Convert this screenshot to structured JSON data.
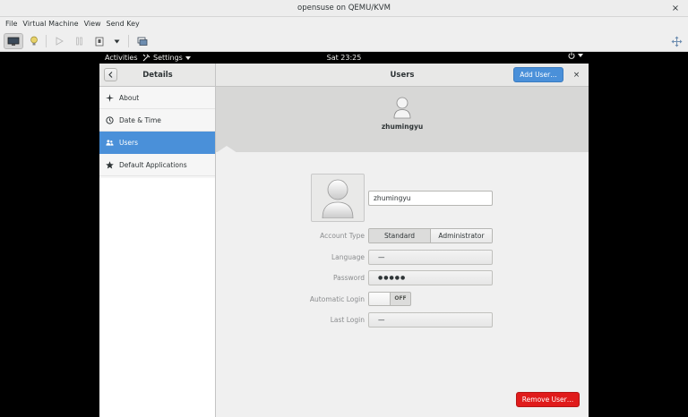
{
  "host": {
    "window_title": "opensuse on QEMU/KVM",
    "close_glyph": "×",
    "menu": [
      "File",
      "Virtual Machine",
      "View",
      "Send Key"
    ],
    "toolbar_icons": [
      "monitor-icon",
      "lightbulb-icon",
      "play-icon",
      "pause-icon",
      "shutdown-icon",
      "dropdown-arrow-icon",
      "snapshot-icon",
      "fullscreen-move-icon"
    ]
  },
  "topbar": {
    "activities": "Activities",
    "app_menu": "Settings",
    "clock": "Sat 23:25"
  },
  "settings": {
    "panel_title": "Details",
    "page_title": "Users",
    "add_user_label": "Add User…",
    "close_glyph": "×",
    "sidebar": [
      {
        "label": "About",
        "icon": "about-star-icon"
      },
      {
        "label": "Date & Time",
        "icon": "clock-icon"
      },
      {
        "label": "Users",
        "icon": "users-icon",
        "selected": true
      },
      {
        "label": "Default Applications",
        "icon": "star-icon"
      }
    ],
    "user": {
      "name": "zhumingyu",
      "full_name_value": "zhumingyu"
    },
    "form": {
      "account_type_label": "Account Type",
      "account_type_options": [
        "Standard",
        "Administrator"
      ],
      "account_type_selected": "Standard",
      "language_label": "Language",
      "language_value": "—",
      "password_label": "Password",
      "password_value": "●●●●●",
      "automatic_login_label": "Automatic Login",
      "automatic_login_state": "OFF",
      "last_login_label": "Last Login",
      "last_login_value": "—"
    },
    "remove_user_label": "Remove User…"
  },
  "colors": {
    "accent": "#4a90d9",
    "destructive": "#e01b1b"
  }
}
